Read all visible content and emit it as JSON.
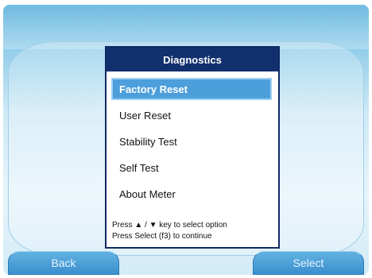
{
  "dialog": {
    "title": "Diagnostics",
    "items": [
      {
        "label": "Factory Reset"
      },
      {
        "label": "User Reset"
      },
      {
        "label": "Stability Test"
      },
      {
        "label": "Self Test"
      },
      {
        "label": "About Meter"
      }
    ],
    "selected_index": 0,
    "hints": [
      "Press ▲ / ▼ key to select option",
      "Press Select (f3) to continue"
    ]
  },
  "softkeys": {
    "left_label": "Back",
    "right_label": "Select"
  },
  "colors": {
    "title_bar": "#12306e",
    "selected_item": "#4d9fdc",
    "softkey": "#3b8fcd"
  }
}
